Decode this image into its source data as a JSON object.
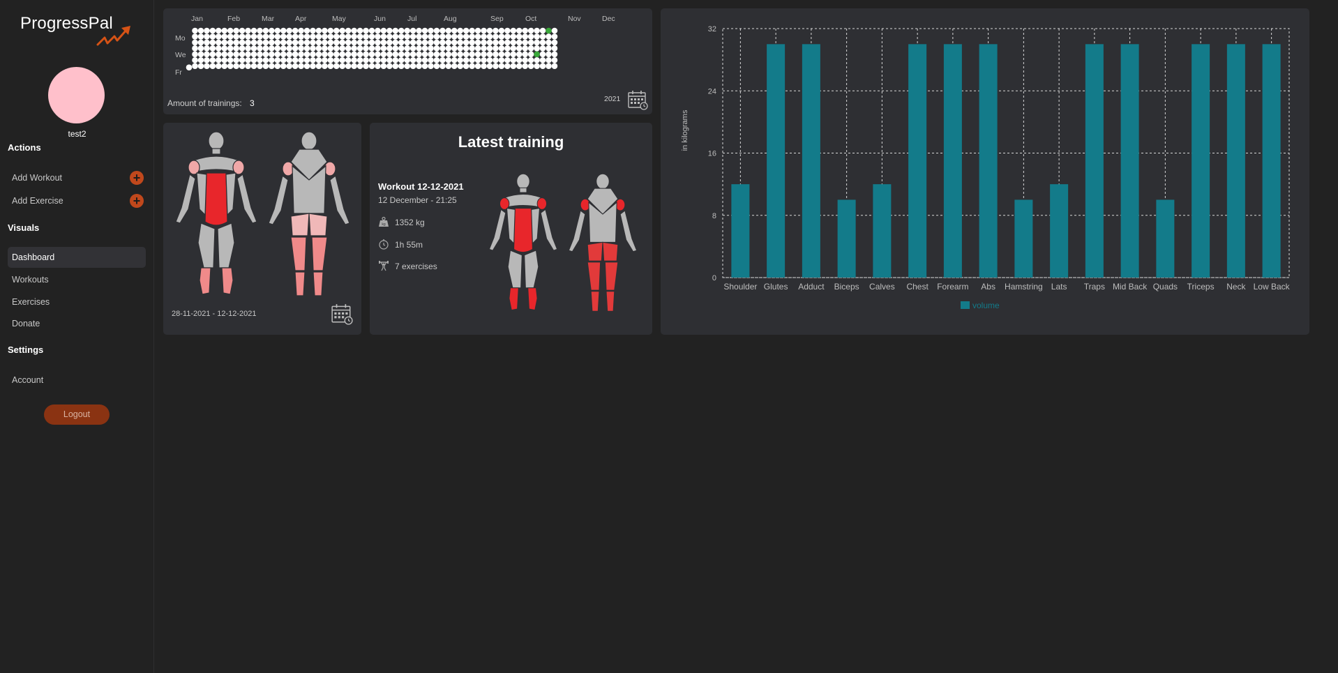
{
  "app": {
    "name": "ProgressPal"
  },
  "user": {
    "name": "test2",
    "avatar_color": "#ffc0cb"
  },
  "sidebar": {
    "actions_heading": "Actions",
    "actions": [
      {
        "label": "Add Workout",
        "icon": "plus-icon"
      },
      {
        "label": "Add Exercise",
        "icon": "plus-icon"
      }
    ],
    "visuals_heading": "Visuals",
    "visuals": [
      {
        "label": "Dashboard",
        "active": true
      },
      {
        "label": "Workouts"
      },
      {
        "label": "Exercises"
      },
      {
        "label": "Donate"
      }
    ],
    "settings_heading": "Settings",
    "settings": [
      {
        "label": "Account"
      }
    ],
    "logout_label": "Logout"
  },
  "heatmap": {
    "months": [
      "Jan",
      "Feb",
      "Mar",
      "Apr",
      "May",
      "Jun",
      "Jul",
      "Aug",
      "Sep",
      "Oct",
      "Nov",
      "Dec"
    ],
    "day_labels": [
      "Mo",
      "We",
      "Fr"
    ],
    "amount_label": "Amount of trainings:",
    "amount_value": "3",
    "year": "2021",
    "active_color": "#3aa83a",
    "inactive_color": "#ffffff",
    "calendar_icon": "calendar-icon"
  },
  "muscle_map": {
    "date_range": "28-11-2021 - 12-12-2021",
    "calendar_icon": "calendar-icon"
  },
  "latest_training": {
    "title": "Latest training",
    "workout_name": "Workout 12-12-2021",
    "date": "12 December - 21:25",
    "volume": "1352 kg",
    "duration": "1h 55m",
    "exercises": "7 exercises",
    "icons": [
      "weight-icon",
      "stopwatch-icon",
      "lifter-icon"
    ]
  },
  "chart_data": {
    "type": "bar",
    "categories": [
      "Shoulder",
      "Glutes",
      "Adduct",
      "Biceps",
      "Calves",
      "Chest",
      "Forearm",
      "Abs",
      "Hamstring",
      "Lats",
      "Traps",
      "Mid Back",
      "Quads",
      "Triceps",
      "Neck",
      "Low Back"
    ],
    "series": [
      {
        "name": "volume",
        "values": [
          12,
          30,
          30,
          10,
          12,
          30,
          30,
          30,
          10,
          12,
          30,
          30,
          10,
          30,
          30,
          30
        ],
        "color": "#137b8a"
      }
    ],
    "ylabel": "in kilograms",
    "yticks": [
      "0",
      "8",
      "16",
      "24",
      "32"
    ],
    "ylim": [
      0,
      32
    ],
    "grid": true,
    "legend": "bottom-center"
  }
}
